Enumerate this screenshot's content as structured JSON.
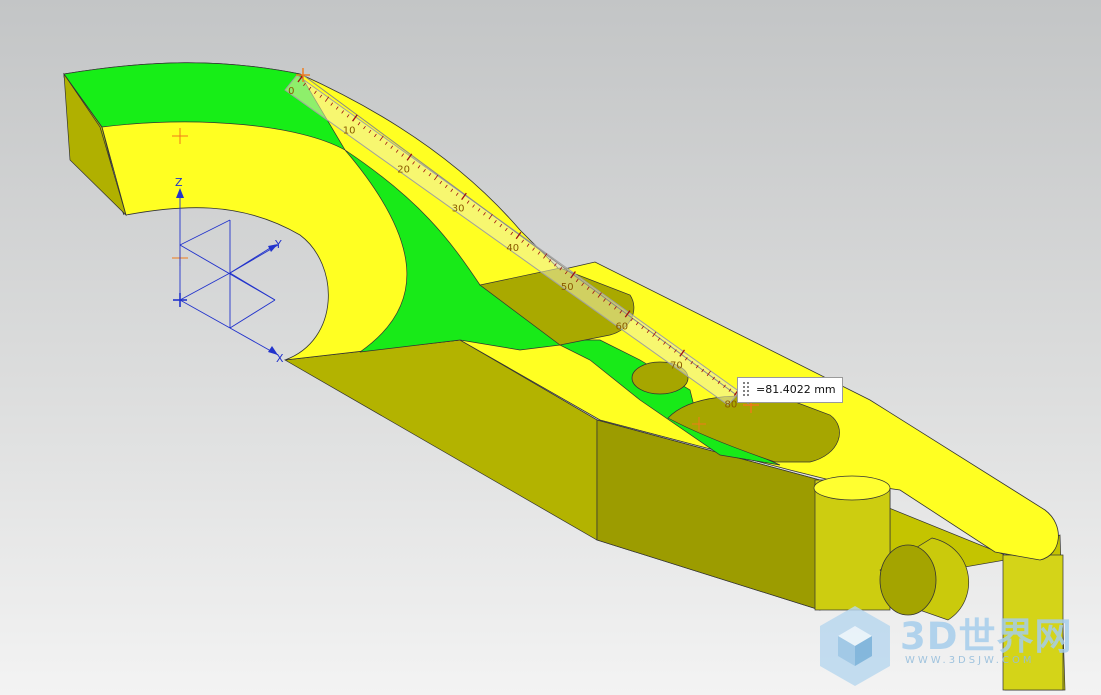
{
  "measurement": {
    "value": "=81.4022 mm"
  },
  "ruler": {
    "tick_labels": [
      "0",
      "10",
      "20",
      "30",
      "40",
      "50",
      "60",
      "70",
      "80"
    ]
  },
  "wcs": {
    "x_label": "X",
    "y_label": "Y",
    "z_label": "Z"
  },
  "watermark": {
    "brand": "3D世界网",
    "url": "WWW.3DSJW.COM"
  },
  "colors": {
    "part_top": "#ffff1f",
    "part_side": "#b9b900",
    "part_side_dark": "#999900",
    "green_face": "#18f018",
    "ruler": "#f2f2a8",
    "wcs": "#2233cc",
    "marker": "#f07a1a"
  }
}
